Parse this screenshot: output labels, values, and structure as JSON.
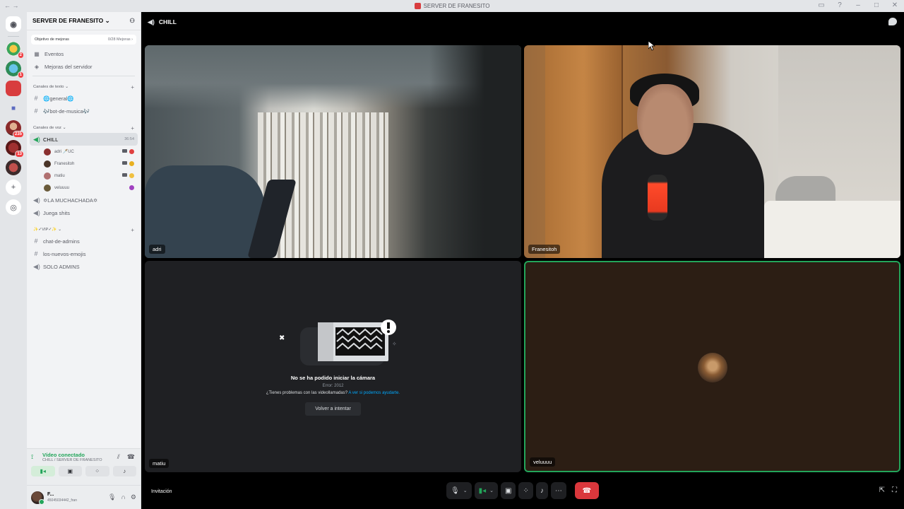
{
  "window": {
    "title": "SERVER DE FRANESITO",
    "colors": {
      "accent_green": "#23a55a",
      "hangup_red": "#da373c",
      "link_blue": "#00a8fc"
    }
  },
  "rail": {
    "badges": [
      "2",
      "1",
      "235",
      "13"
    ]
  },
  "server": {
    "name": "SERVER DE FRANESITO",
    "boost_label": "Objetivo de mejoras",
    "boost_progress": "0/28 Mejoras",
    "events": "Eventos",
    "boosts": "Mejoras del servidor"
  },
  "categories": {
    "text": "Canales de texto",
    "voice": "Canales de voz",
    "vip": "✨✓VIP✓✨"
  },
  "text_channels": [
    {
      "name": "🌐general🌐"
    },
    {
      "name": "🎶bot-de-musica🎶"
    }
  ],
  "voice_channel": {
    "name": "CHILL",
    "elapsed": "36:54",
    "users": [
      {
        "name": "adri 🗡️UC"
      },
      {
        "name": "Franesitoh"
      },
      {
        "name": "matiu"
      },
      {
        "name": "veluuuu"
      }
    ]
  },
  "other_voice": [
    {
      "name": "✡LA MUCHACHADA✡"
    },
    {
      "name": "Juega shits"
    }
  ],
  "vip_channels": [
    {
      "name": "chat-de-admins",
      "type": "text"
    },
    {
      "name": "los-nuevos-emojis",
      "type": "text"
    },
    {
      "name": "SOLO ADMINS",
      "type": "voice"
    }
  ],
  "voice_panel": {
    "title": "Vídeo conectado",
    "subtitle": "CHILL / SERVER DE FRANESITO"
  },
  "user": {
    "name": "F...",
    "tag": "45045034442_fran"
  },
  "call": {
    "header": "CHILL",
    "tiles": [
      {
        "name": "adri"
      },
      {
        "name": "Franesitoh"
      },
      {
        "name": "matiu"
      },
      {
        "name": "veluuuu"
      }
    ],
    "error_title": "No se ha podido iniciar la cámara",
    "error_code": "Error: 2012",
    "error_help": "¿Tienes problemas con las videollamadas?",
    "error_link": "A ver si podemos ayudarte.",
    "retry": "Volver a intentar",
    "invite": "Invitación"
  },
  "icons": [
    "discord-icon",
    "folder-icon",
    "add-server-icon",
    "explore-icon",
    "calendar-icon",
    "boost-icon",
    "hash-icon",
    "speaker-icon",
    "mic-icon",
    "camera-icon",
    "screenshare-icon",
    "activity-icon",
    "soundboard-icon",
    "more-icon",
    "hangup-icon",
    "popout-icon",
    "fullscreen-icon",
    "chat-icon",
    "gear-icon",
    "headset-icon"
  ]
}
